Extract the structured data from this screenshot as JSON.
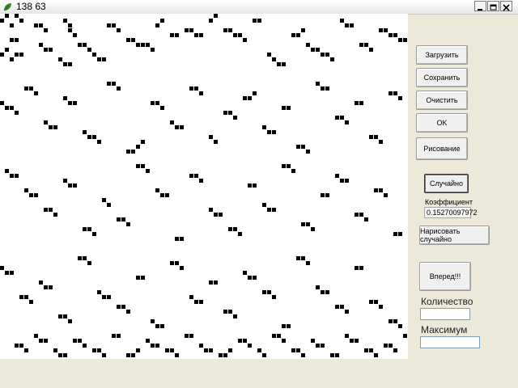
{
  "window": {
    "title": "138 63",
    "icon": "leaf-icon",
    "controls": {
      "minimize_icon": "minimize-icon",
      "maximize_icon": "maximize-icon",
      "close_icon": "close-icon"
    }
  },
  "board": {
    "background": "#ffffff",
    "cell_color": "#000000",
    "cells": [
      [
        0,
        1
      ],
      [
        1,
        0
      ],
      [
        2,
        2
      ],
      [
        3,
        0
      ],
      [
        4,
        1
      ],
      [
        2,
        5
      ],
      [
        3,
        5
      ],
      [
        1,
        7
      ],
      [
        0,
        8
      ],
      [
        2,
        9
      ],
      [
        3,
        8
      ],
      [
        4,
        8
      ],
      [
        7,
        2
      ],
      [
        8,
        2
      ],
      [
        9,
        3
      ],
      [
        8,
        6
      ],
      [
        9,
        7
      ],
      [
        10,
        7
      ],
      [
        13,
        1
      ],
      [
        14,
        2
      ],
      [
        14,
        3
      ],
      [
        15,
        4
      ],
      [
        12,
        9
      ],
      [
        13,
        10
      ],
      [
        14,
        10
      ],
      [
        16,
        6
      ],
      [
        17,
        6
      ],
      [
        18,
        7
      ],
      [
        19,
        8
      ],
      [
        20,
        9
      ],
      [
        21,
        9
      ],
      [
        22,
        2
      ],
      [
        23,
        2
      ],
      [
        24,
        3
      ],
      [
        26,
        5
      ],
      [
        27,
        5
      ],
      [
        28,
        6
      ],
      [
        29,
        6
      ],
      [
        30,
        6
      ],
      [
        31,
        7
      ],
      [
        32,
        2
      ],
      [
        33,
        1
      ],
      [
        35,
        4
      ],
      [
        36,
        4
      ],
      [
        38,
        3
      ],
      [
        39,
        3
      ],
      [
        40,
        4
      ],
      [
        41,
        4
      ],
      [
        43,
        1
      ],
      [
        44,
        0
      ],
      [
        46,
        3
      ],
      [
        47,
        3
      ],
      [
        48,
        4
      ],
      [
        49,
        4
      ],
      [
        50,
        5
      ],
      [
        52,
        1
      ],
      [
        53,
        1
      ],
      [
        55,
        8
      ],
      [
        56,
        9
      ],
      [
        57,
        10
      ],
      [
        58,
        10
      ],
      [
        60,
        4
      ],
      [
        61,
        4
      ],
      [
        62,
        3
      ],
      [
        63,
        6
      ],
      [
        64,
        7
      ],
      [
        65,
        7
      ],
      [
        66,
        8
      ],
      [
        67,
        8
      ],
      [
        68,
        9
      ],
      [
        70,
        1
      ],
      [
        71,
        2
      ],
      [
        72,
        2
      ],
      [
        74,
        6
      ],
      [
        75,
        6
      ],
      [
        76,
        7
      ],
      [
        78,
        3
      ],
      [
        79,
        3
      ],
      [
        80,
        4
      ],
      [
        81,
        4
      ],
      [
        82,
        5
      ],
      [
        83,
        5
      ],
      [
        84,
        6
      ],
      [
        0,
        18
      ],
      [
        1,
        19
      ],
      [
        2,
        19
      ],
      [
        3,
        20
      ],
      [
        5,
        15
      ],
      [
        6,
        15
      ],
      [
        7,
        16
      ],
      [
        9,
        22
      ],
      [
        10,
        23
      ],
      [
        11,
        23
      ],
      [
        13,
        17
      ],
      [
        14,
        18
      ],
      [
        15,
        18
      ],
      [
        17,
        24
      ],
      [
        18,
        25
      ],
      [
        19,
        25
      ],
      [
        20,
        26
      ],
      [
        22,
        14
      ],
      [
        23,
        14
      ],
      [
        24,
        15
      ],
      [
        26,
        28
      ],
      [
        27,
        28
      ],
      [
        28,
        27
      ],
      [
        29,
        26
      ],
      [
        31,
        18
      ],
      [
        32,
        18
      ],
      [
        33,
        19
      ],
      [
        35,
        22
      ],
      [
        36,
        23
      ],
      [
        37,
        23
      ],
      [
        39,
        15
      ],
      [
        40,
        15
      ],
      [
        41,
        16
      ],
      [
        43,
        25
      ],
      [
        44,
        26
      ],
      [
        46,
        20
      ],
      [
        47,
        20
      ],
      [
        48,
        21
      ],
      [
        50,
        17
      ],
      [
        51,
        17
      ],
      [
        52,
        16
      ],
      [
        54,
        23
      ],
      [
        55,
        24
      ],
      [
        56,
        24
      ],
      [
        58,
        19
      ],
      [
        59,
        19
      ],
      [
        61,
        27
      ],
      [
        62,
        27
      ],
      [
        63,
        28
      ],
      [
        65,
        14
      ],
      [
        66,
        15
      ],
      [
        67,
        15
      ],
      [
        69,
        21
      ],
      [
        70,
        21
      ],
      [
        71,
        22
      ],
      [
        73,
        18
      ],
      [
        74,
        18
      ],
      [
        76,
        25
      ],
      [
        77,
        25
      ],
      [
        78,
        26
      ],
      [
        80,
        16
      ],
      [
        81,
        16
      ],
      [
        82,
        17
      ],
      [
        1,
        32
      ],
      [
        2,
        33
      ],
      [
        3,
        33
      ],
      [
        5,
        36
      ],
      [
        6,
        37
      ],
      [
        7,
        37
      ],
      [
        9,
        40
      ],
      [
        10,
        40
      ],
      [
        11,
        41
      ],
      [
        13,
        34
      ],
      [
        14,
        35
      ],
      [
        15,
        35
      ],
      [
        17,
        44
      ],
      [
        18,
        44
      ],
      [
        19,
        45
      ],
      [
        21,
        38
      ],
      [
        22,
        39
      ],
      [
        24,
        42
      ],
      [
        25,
        42
      ],
      [
        26,
        43
      ],
      [
        28,
        31
      ],
      [
        29,
        31
      ],
      [
        30,
        32
      ],
      [
        32,
        36
      ],
      [
        33,
        37
      ],
      [
        34,
        37
      ],
      [
        36,
        46
      ],
      [
        37,
        46
      ],
      [
        39,
        33
      ],
      [
        40,
        33
      ],
      [
        41,
        34
      ],
      [
        43,
        40
      ],
      [
        44,
        41
      ],
      [
        45,
        41
      ],
      [
        47,
        44
      ],
      [
        48,
        44
      ],
      [
        49,
        45
      ],
      [
        51,
        35
      ],
      [
        52,
        35
      ],
      [
        54,
        39
      ],
      [
        55,
        40
      ],
      [
        56,
        40
      ],
      [
        58,
        31
      ],
      [
        59,
        31
      ],
      [
        60,
        32
      ],
      [
        62,
        43
      ],
      [
        63,
        43
      ],
      [
        64,
        44
      ],
      [
        66,
        37
      ],
      [
        67,
        37
      ],
      [
        69,
        33
      ],
      [
        70,
        34
      ],
      [
        71,
        34
      ],
      [
        73,
        41
      ],
      [
        74,
        41
      ],
      [
        75,
        42
      ],
      [
        77,
        36
      ],
      [
        78,
        36
      ],
      [
        79,
        37
      ],
      [
        81,
        45
      ],
      [
        82,
        45
      ],
      [
        0,
        52
      ],
      [
        1,
        53
      ],
      [
        2,
        53
      ],
      [
        4,
        58
      ],
      [
        5,
        58
      ],
      [
        6,
        59
      ],
      [
        8,
        55
      ],
      [
        9,
        56
      ],
      [
        10,
        56
      ],
      [
        12,
        62
      ],
      [
        13,
        62
      ],
      [
        14,
        63
      ],
      [
        16,
        50
      ],
      [
        17,
        50
      ],
      [
        18,
        51
      ],
      [
        20,
        57
      ],
      [
        21,
        58
      ],
      [
        22,
        58
      ],
      [
        24,
        60
      ],
      [
        25,
        60
      ],
      [
        26,
        61
      ],
      [
        28,
        54
      ],
      [
        29,
        54
      ],
      [
        31,
        63
      ],
      [
        32,
        64
      ],
      [
        33,
        64
      ],
      [
        35,
        51
      ],
      [
        36,
        51
      ],
      [
        37,
        52
      ],
      [
        39,
        58
      ],
      [
        40,
        59
      ],
      [
        41,
        59
      ],
      [
        43,
        55
      ],
      [
        44,
        55
      ],
      [
        46,
        61
      ],
      [
        47,
        61
      ],
      [
        48,
        62
      ],
      [
        50,
        53
      ],
      [
        51,
        54
      ],
      [
        52,
        54
      ],
      [
        54,
        57
      ],
      [
        55,
        57
      ],
      [
        56,
        58
      ],
      [
        58,
        64
      ],
      [
        59,
        64
      ],
      [
        61,
        50
      ],
      [
        62,
        50
      ],
      [
        63,
        51
      ],
      [
        65,
        56
      ],
      [
        66,
        57
      ],
      [
        67,
        57
      ],
      [
        69,
        60
      ],
      [
        70,
        60
      ],
      [
        71,
        61
      ],
      [
        73,
        52
      ],
      [
        74,
        52
      ],
      [
        76,
        59
      ],
      [
        77,
        59
      ],
      [
        78,
        60
      ],
      [
        80,
        63
      ],
      [
        81,
        63
      ],
      [
        82,
        64
      ],
      [
        3,
        68
      ],
      [
        4,
        68
      ],
      [
        5,
        69
      ],
      [
        7,
        66
      ],
      [
        8,
        67
      ],
      [
        9,
        67
      ],
      [
        11,
        69
      ],
      [
        12,
        70
      ],
      [
        13,
        70
      ],
      [
        15,
        67
      ],
      [
        16,
        67
      ],
      [
        17,
        68
      ],
      [
        19,
        69
      ],
      [
        20,
        69
      ],
      [
        21,
        70
      ],
      [
        23,
        66
      ],
      [
        24,
        66
      ],
      [
        26,
        70
      ],
      [
        27,
        70
      ],
      [
        28,
        69
      ],
      [
        30,
        67
      ],
      [
        31,
        68
      ],
      [
        32,
        68
      ],
      [
        34,
        69
      ],
      [
        35,
        69
      ],
      [
        36,
        70
      ],
      [
        38,
        66
      ],
      [
        39,
        66
      ],
      [
        41,
        68
      ],
      [
        42,
        69
      ],
      [
        43,
        69
      ],
      [
        45,
        70
      ],
      [
        46,
        70
      ],
      [
        47,
        69
      ],
      [
        49,
        67
      ],
      [
        50,
        67
      ],
      [
        51,
        68
      ],
      [
        53,
        69
      ],
      [
        54,
        70
      ],
      [
        56,
        66
      ],
      [
        57,
        66
      ],
      [
        58,
        67
      ],
      [
        60,
        69
      ],
      [
        61,
        69
      ],
      [
        62,
        70
      ],
      [
        64,
        67
      ],
      [
        65,
        68
      ],
      [
        66,
        68
      ],
      [
        68,
        70
      ],
      [
        69,
        70
      ],
      [
        71,
        66
      ],
      [
        72,
        67
      ],
      [
        73,
        67
      ],
      [
        75,
        69
      ],
      [
        76,
        69
      ],
      [
        77,
        70
      ],
      [
        79,
        68
      ],
      [
        80,
        68
      ],
      [
        81,
        69
      ],
      [
        83,
        66
      ]
    ]
  },
  "sidebar": {
    "load_button": "Загрузить",
    "save_button": "Сохранить",
    "clear_button": "Очистить",
    "ok_button": "OK",
    "draw_button": "Рисование",
    "random_button": "Случайно",
    "coefficient_label": "Коэффициент",
    "coefficient_value": "0.15270097972",
    "draw_random_button": "Нарисовать случайно",
    "forward_button": "Вперед!!!",
    "count_label": "Количество",
    "count_value": "",
    "max_label": "Максимум",
    "max_value": ""
  }
}
